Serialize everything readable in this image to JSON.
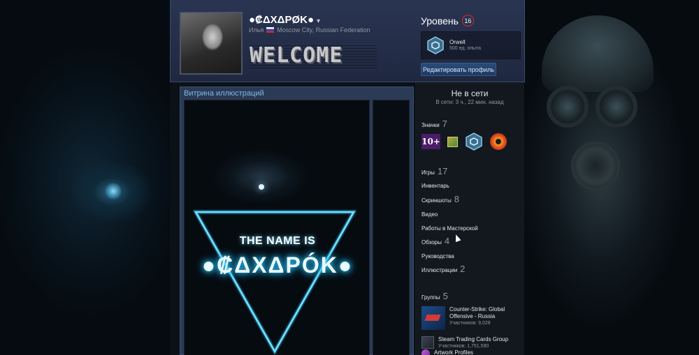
{
  "profile": {
    "name": "●₡ΔXΔPØK●",
    "real_name": "Илья",
    "location": "Moscow City, Russian Federation",
    "banner_text": "WELCOME"
  },
  "level": {
    "label": "Уровень",
    "value": "16"
  },
  "featured_badge": {
    "title": "Orwell",
    "xp": "500 ед. опыта"
  },
  "edit_profile_label": "Редактировать профиль",
  "showcase": {
    "title": "Витрина иллюстраций",
    "art_line1": "THE NAME IS",
    "art_line2": "●₡ΔXΔPÓK●"
  },
  "status": {
    "title": "Не в сети",
    "last_seen": "В сети: 3 ч., 22 мин. назад"
  },
  "sidebar": {
    "badges": {
      "label": "Значки",
      "count": "7",
      "first_badge_text": "10+"
    },
    "games": {
      "label": "Игры",
      "count": "17"
    },
    "inventory": {
      "label": "Инвентарь"
    },
    "screenshots": {
      "label": "Скриншоты",
      "count": "8"
    },
    "videos": {
      "label": "Видео"
    },
    "workshop": {
      "label": "Работы в Мастерской"
    },
    "reviews": {
      "label": "Обзоры",
      "count": "4"
    },
    "guides": {
      "label": "Руководства"
    },
    "artwork": {
      "label": "Иллюстрации",
      "count": "2"
    },
    "groups": {
      "label": "Группы",
      "count": "5"
    }
  },
  "groups": [
    {
      "name": "Counter-Strike: Global Offensive - Russia",
      "members": "Участников: 9,028"
    },
    {
      "name": "Steam Trading Cards Group",
      "members": "Участников: 1,751,590"
    },
    {
      "name": "Artwork Profiles",
      "members": ""
    }
  ],
  "colors": {
    "accent_link": "#7cb8e8",
    "header_bg": "#2a3552",
    "level_ring": "#d42c2c",
    "neon": "#2ec7ff"
  }
}
